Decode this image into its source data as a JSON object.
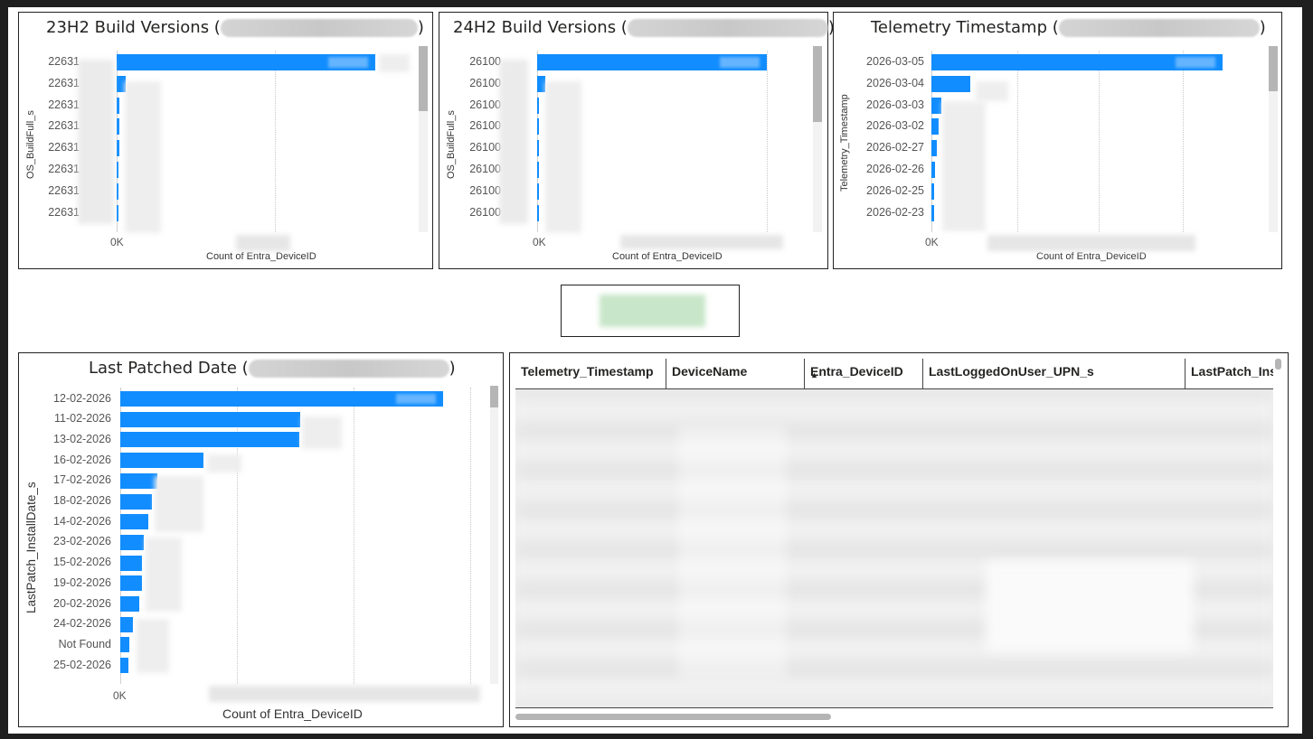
{
  "charts": {
    "h23": {
      "title": "23H2 Build Versions (",
      "title_close": ")",
      "ylabel": "OS_BuildFull_s",
      "xlabel": "Count of Entra_DeviceID",
      "zero_tick": "0K"
    },
    "h24": {
      "title": "24H2 Build Versions (",
      "title_close": ")",
      "ylabel": "OS_BuildFull_s",
      "xlabel": "Count of Entra_DeviceID",
      "zero_tick": "0K"
    },
    "tele": {
      "title": "Telemetry Timestamp (",
      "title_close": ")",
      "ylabel": "Telemetry_Timestamp",
      "xlabel": "Count of Entra_DeviceID",
      "zero_tick": "0K"
    },
    "patch": {
      "title": "Last Patched Date (",
      "title_close": ")",
      "ylabel": "LastPatch_InstallDate_s",
      "xlabel": "Count of Entra_DeviceID",
      "zero_tick": "0K"
    }
  },
  "chart_data": [
    {
      "type": "bar",
      "orientation": "horizontal",
      "title": "23H2 Build Versions (",
      "xlabel": "Count of Entra_DeviceID",
      "ylabel": "OS_BuildFull_s",
      "categories": [
        "22631",
        "22631",
        "22631",
        "22631",
        "22631",
        "22631",
        "22631",
        "22631"
      ],
      "values": [
        1.0,
        0.035,
        0.012,
        0.01,
        0.009,
        0.008,
        0.007,
        0.006
      ],
      "value_unit": "fraction of largest bar"
    },
    {
      "type": "bar",
      "orientation": "horizontal",
      "title": "24H2 Build Versions (",
      "xlabel": "Count of Entra_DeviceID",
      "ylabel": "OS_BuildFull_s",
      "categories": [
        "26100",
        "26100",
        "26100",
        "26100",
        "26100",
        "26100",
        "26100",
        "26100"
      ],
      "values": [
        1.0,
        0.035,
        0.008,
        0.007,
        0.006,
        0.006,
        0.005,
        0.005
      ],
      "value_unit": "fraction of largest bar"
    },
    {
      "type": "bar",
      "orientation": "horizontal",
      "title": "Telemetry Timestamp (",
      "xlabel": "Count of Entra_DeviceID",
      "ylabel": "Telemetry_Timestamp",
      "categories": [
        "2026-03-05",
        "2026-03-04",
        "2026-03-03",
        "2026-03-02",
        "2026-02-27",
        "2026-02-26",
        "2026-02-25",
        "2026-02-23"
      ],
      "values": [
        1.0,
        0.135,
        0.035,
        0.025,
        0.018,
        0.012,
        0.01,
        0.008
      ],
      "value_unit": "fraction of largest bar"
    },
    {
      "type": "bar",
      "orientation": "horizontal",
      "title": "Last Patched Date (",
      "xlabel": "Count of Entra_DeviceID",
      "ylabel": "LastPatch_InstallDate_s",
      "categories": [
        "12-02-2026",
        "11-02-2026",
        "13-02-2026",
        "16-02-2026",
        "17-02-2026",
        "18-02-2026",
        "14-02-2026",
        "23-02-2026",
        "15-02-2026",
        "19-02-2026",
        "20-02-2026",
        "24-02-2026",
        "Not Found",
        "25-02-2026"
      ],
      "values": [
        1.0,
        0.557,
        0.555,
        0.258,
        0.114,
        0.097,
        0.088,
        0.074,
        0.066,
        0.066,
        0.058,
        0.04,
        0.027,
        0.026
      ],
      "value_unit": "fraction of largest bar"
    }
  ],
  "table": {
    "columns": [
      "Telemetry_Timestamp",
      "DeviceName",
      "Entra_DeviceID",
      "LastLoggedOnUser_UPN_s",
      "LastPatch_Ins"
    ],
    "sort_indicator": "▲"
  },
  "colors": {
    "bar": "#118dff",
    "card_green": "#c8e6c9"
  }
}
